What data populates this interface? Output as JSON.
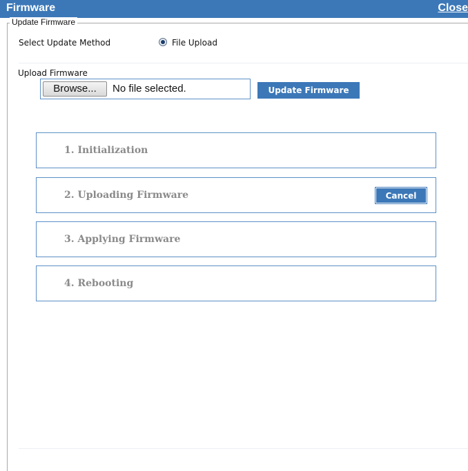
{
  "window": {
    "title": "Firmware",
    "close_label": "Close"
  },
  "fieldset": {
    "legend": "Update Firmware"
  },
  "method": {
    "label": "Select Update Method",
    "option_label": "File Upload",
    "selected": true
  },
  "upload": {
    "label": "Upload Firmware",
    "browse_label": "Browse...",
    "file_status": "No file selected.",
    "update_button_label": "Update Firmware"
  },
  "steps": [
    {
      "label": "1. Initialization"
    },
    {
      "label": "2. Uploading Firmware",
      "cancel_label": "Cancel"
    },
    {
      "label": "3. Applying Firmware"
    },
    {
      "label": "4. Rebooting"
    }
  ],
  "colors": {
    "accent": "#3c78b8",
    "step_border": "#5b8fc5",
    "step_text": "#8a8a8a"
  }
}
